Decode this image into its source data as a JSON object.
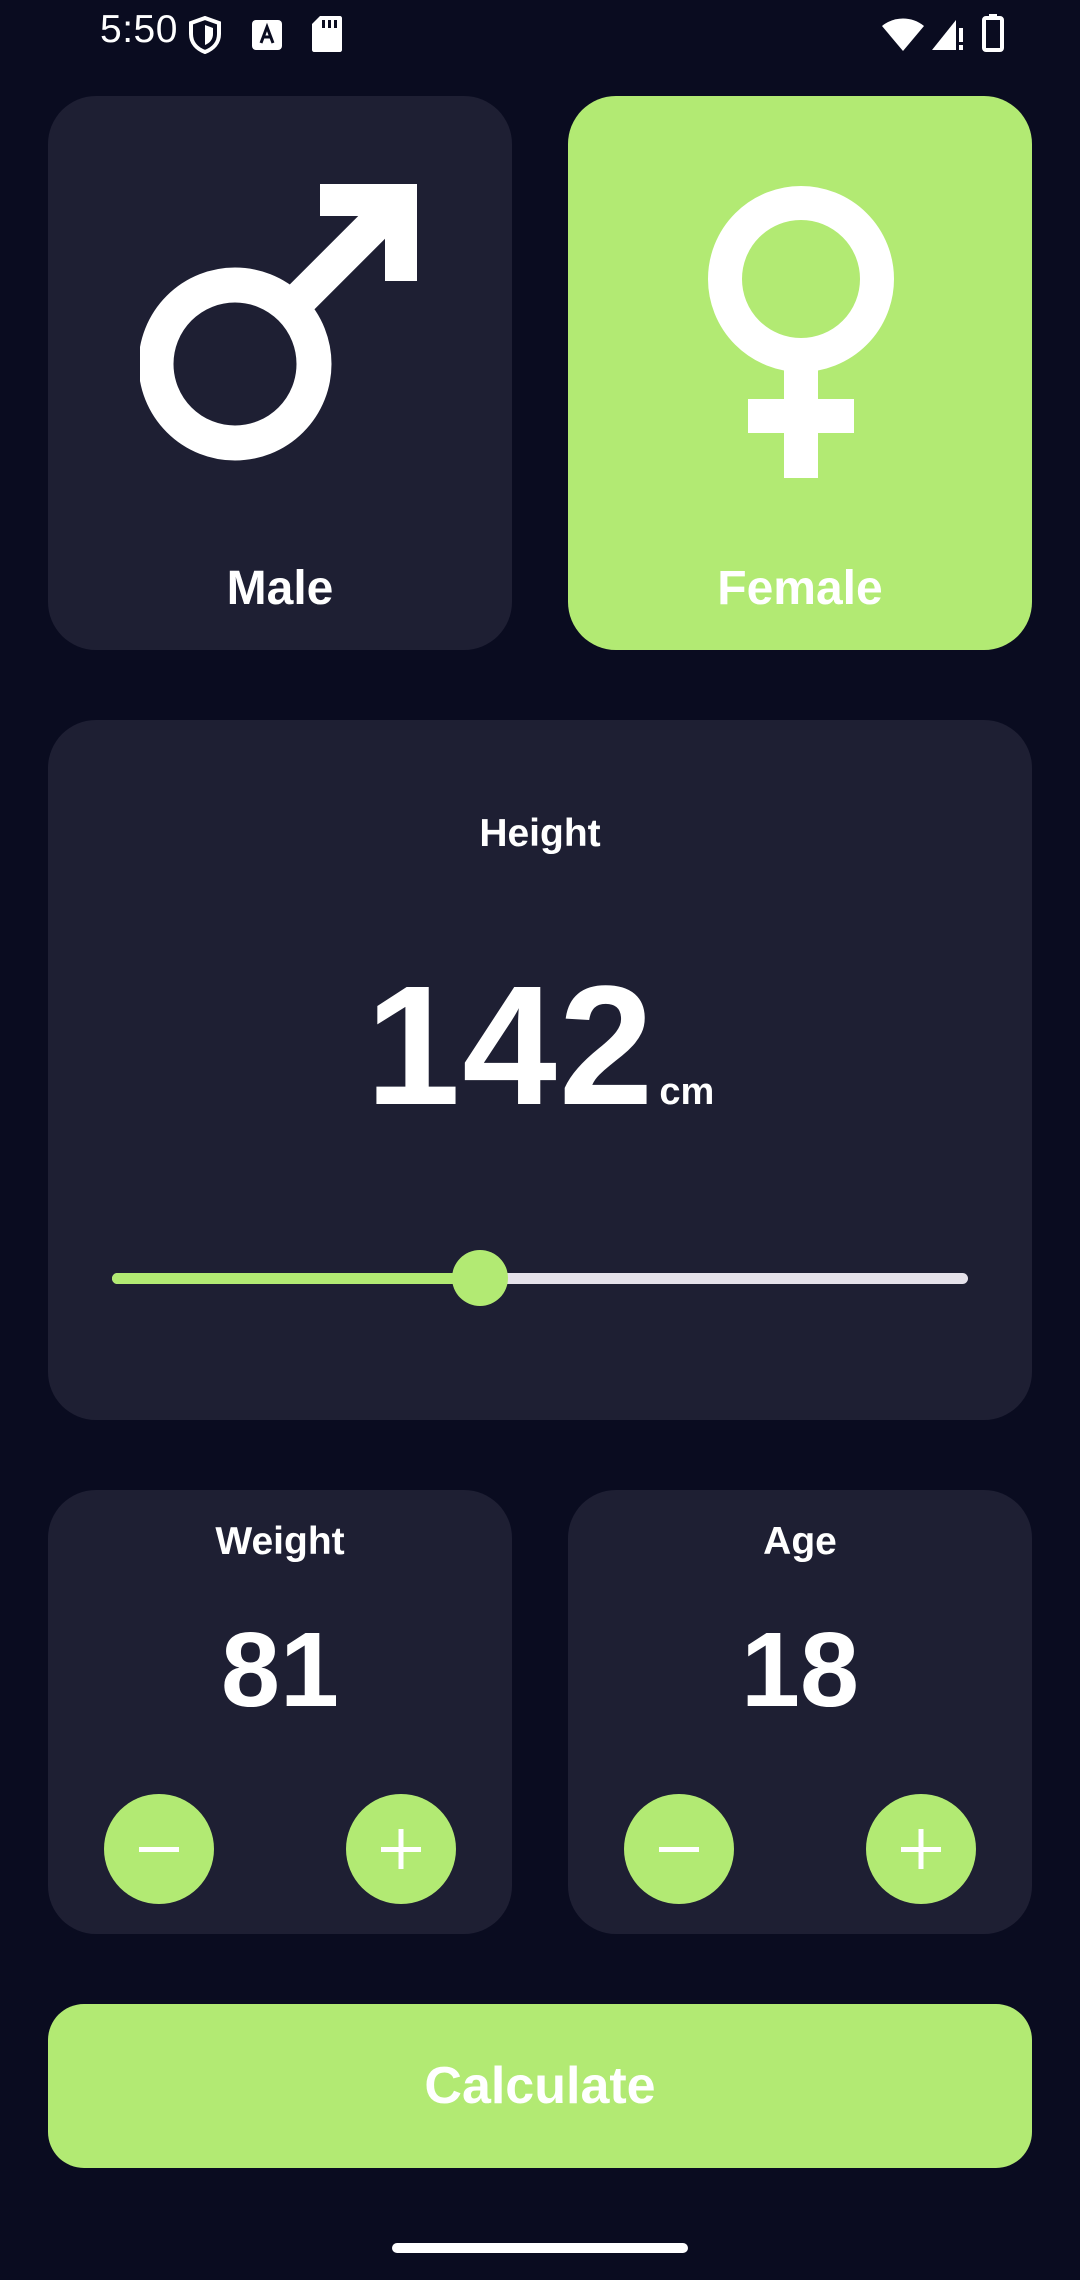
{
  "status_bar": {
    "time": "5:50",
    "icons": [
      "shield-icon",
      "text-a-icon",
      "sd-card-icon",
      "wifi-icon",
      "signal-icon",
      "battery-icon"
    ]
  },
  "gender": {
    "male_label": "Male",
    "female_label": "Female",
    "selected": "Female"
  },
  "height": {
    "label": "Height",
    "value": "142",
    "unit": "cm",
    "slider_fraction": 0.43
  },
  "weight": {
    "label": "Weight",
    "value": "81"
  },
  "age": {
    "label": "Age",
    "value": "18"
  },
  "calculate": {
    "label": "Calculate"
  },
  "colors": {
    "background": "#0a0c20",
    "card": "#1e1f33",
    "accent": "#b2ea73",
    "text": "#ffffff",
    "slider_inactive": "#e5e1ea"
  }
}
